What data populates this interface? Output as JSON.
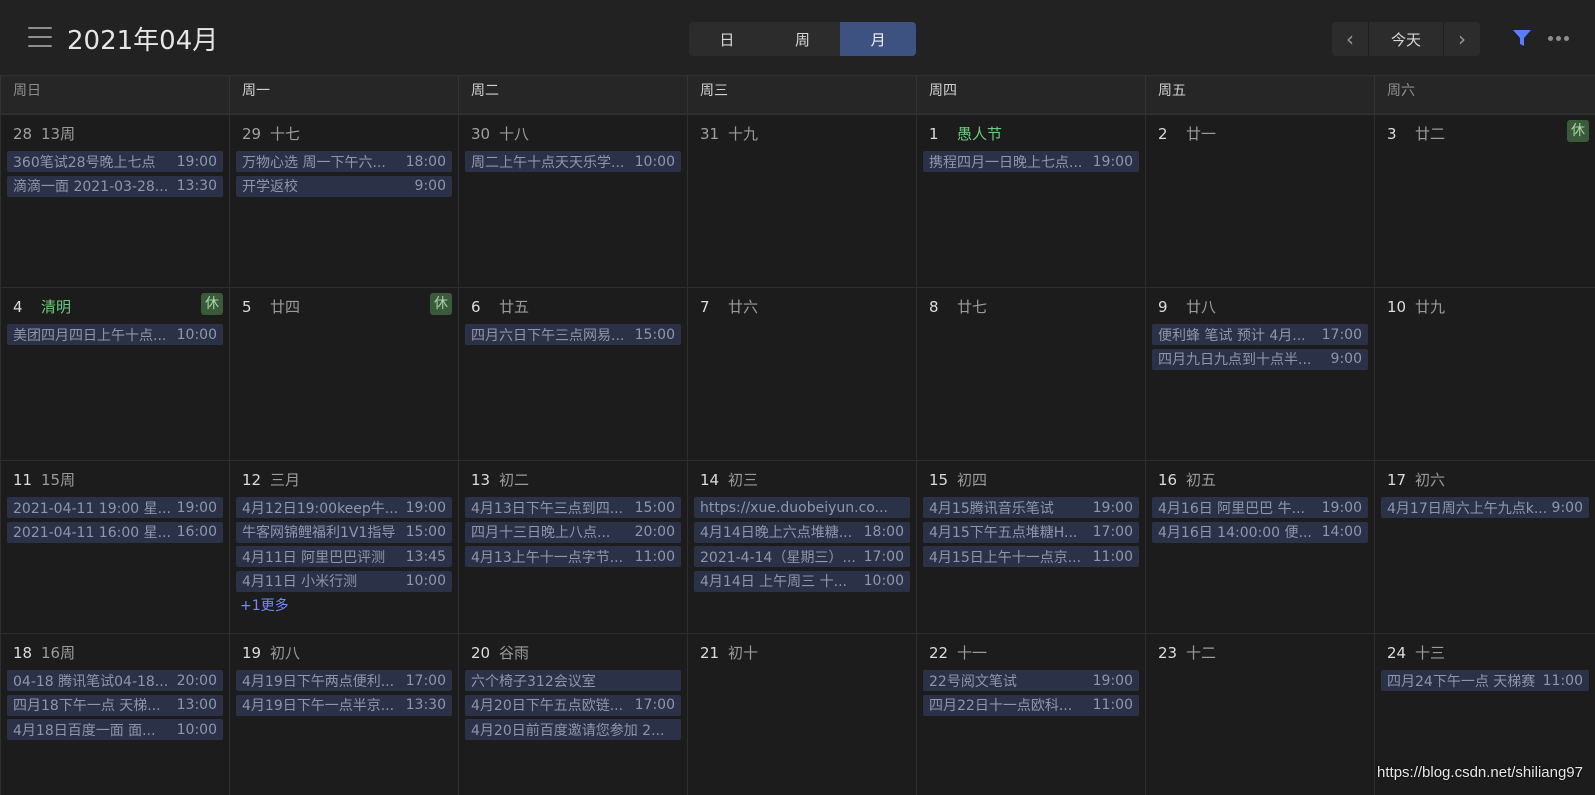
{
  "header": {
    "title": "2021年04月",
    "menu_icon": "hamburger-menu-icon",
    "views": [
      {
        "label": "日",
        "active": false
      },
      {
        "label": "周",
        "active": false
      },
      {
        "label": "月",
        "active": true
      }
    ],
    "nav": {
      "prev_icon": "chevron-left-icon",
      "today_label": "今天",
      "next_icon": "chevron-right-icon"
    },
    "filter_icon": "filter-icon",
    "more_icon": "more-horizontal-icon",
    "accent_color": "#3e5282",
    "filter_color": "#5a7dff"
  },
  "weekdays": [
    "周日",
    "周一",
    "周二",
    "周三",
    "周四",
    "周五",
    "周六"
  ],
  "weeks": [
    [
      {
        "day": "28",
        "lunar": "13周",
        "prev": true,
        "events": [
          {
            "title": "360笔试28号晚上七点",
            "time": "19:00"
          },
          {
            "title": "滴滴一面 2021-03-28...",
            "time": "13:30"
          }
        ]
      },
      {
        "day": "29",
        "lunar": "十七",
        "prev": true,
        "events": [
          {
            "title": "万物心选 周一下午六...",
            "time": "18:00"
          },
          {
            "title": "开学返校",
            "time": "9:00"
          }
        ]
      },
      {
        "day": "30",
        "lunar": "十八",
        "prev": true,
        "events": [
          {
            "title": "周二上午十点天天乐学...",
            "time": "10:00"
          }
        ]
      },
      {
        "day": "31",
        "lunar": "十九",
        "prev": true,
        "events": []
      },
      {
        "day": "1",
        "lunar": "愚人节",
        "festival": true,
        "events": [
          {
            "title": "携程四月一日晚上七点...",
            "time": "19:00"
          }
        ]
      },
      {
        "day": "2",
        "lunar": "廿一",
        "events": []
      },
      {
        "day": "3",
        "lunar": "廿二",
        "rest": "休",
        "events": []
      }
    ],
    [
      {
        "day": "4",
        "lunar": "清明",
        "festival": true,
        "rest": "休",
        "events": [
          {
            "title": "美团四月四日上午十点...",
            "time": "10:00"
          }
        ]
      },
      {
        "day": "5",
        "lunar": "廿四",
        "rest": "休",
        "events": []
      },
      {
        "day": "6",
        "lunar": "廿五",
        "events": [
          {
            "title": "四月六日下午三点网易...",
            "time": "15:00"
          }
        ]
      },
      {
        "day": "7",
        "lunar": "廿六",
        "events": []
      },
      {
        "day": "8",
        "lunar": "廿七",
        "events": []
      },
      {
        "day": "9",
        "lunar": "廿八",
        "events": [
          {
            "title": "便利蜂 笔试 预计 4月...",
            "time": "17:00"
          },
          {
            "title": "四月九日九点到十点半...",
            "time": "9:00"
          }
        ]
      },
      {
        "day": "10",
        "lunar": "廿九",
        "events": []
      }
    ],
    [
      {
        "day": "11",
        "lunar": "15周",
        "events": [
          {
            "title": "2021-04-11 19:00 星...",
            "time": "19:00"
          },
          {
            "title": "2021-04-11 16:00 星...",
            "time": "16:00"
          }
        ]
      },
      {
        "day": "12",
        "lunar": "三月",
        "more": "+1更多",
        "events": [
          {
            "title": "4月12日19:00keep牛...",
            "time": "19:00"
          },
          {
            "title": "牛客网锦鲤福利1V1指导",
            "time": "15:00"
          },
          {
            "title": "4月11日 阿里巴巴评测",
            "time": "13:45"
          },
          {
            "title": "4月11日 小米行测",
            "time": "10:00"
          }
        ]
      },
      {
        "day": "13",
        "lunar": "初二",
        "events": [
          {
            "title": "4月13日下午三点到四...",
            "time": "15:00"
          },
          {
            "title": "四月十三日晚上八点...",
            "time": "20:00"
          },
          {
            "title": "4月13上午十一点字节...",
            "time": "11:00"
          }
        ]
      },
      {
        "day": "14",
        "lunar": "初三",
        "events": [
          {
            "title": "https://xue.duobeiyun.co...",
            "time": ""
          },
          {
            "title": "4月14日晚上六点堆糖...",
            "time": "18:00"
          },
          {
            "title": "2021-4-14（星期三）...",
            "time": "17:00"
          },
          {
            "title": "4月14日 上午周三 十...",
            "time": "10:00"
          }
        ]
      },
      {
        "day": "15",
        "lunar": "初四",
        "events": [
          {
            "title": "4月15腾讯音乐笔试",
            "time": "19:00"
          },
          {
            "title": "4月15下午五点堆糖H...",
            "time": "17:00"
          },
          {
            "title": "4月15日上午十一点京...",
            "time": "11:00"
          }
        ]
      },
      {
        "day": "16",
        "lunar": "初五",
        "events": [
          {
            "title": "4月16日 阿里巴巴 牛...",
            "time": "19:00"
          },
          {
            "title": "4月16日 14:00:00 便...",
            "time": "14:00"
          }
        ]
      },
      {
        "day": "17",
        "lunar": "初六",
        "events": [
          {
            "title": "4月17日周六上午九点k...",
            "time": "9:00"
          }
        ]
      }
    ],
    [
      {
        "day": "18",
        "lunar": "16周",
        "events": [
          {
            "title": "04-18 腾讯笔试04-18...",
            "time": "20:00"
          },
          {
            "title": "四月18下午一点 天梯...",
            "time": "13:00"
          },
          {
            "title": "4月18日百度一面 面...",
            "time": "10:00"
          }
        ]
      },
      {
        "day": "19",
        "lunar": "初八",
        "events": [
          {
            "title": "4月19日下午两点便利...",
            "time": "17:00"
          },
          {
            "title": "4月19日下午一点半京...",
            "time": "13:30"
          }
        ]
      },
      {
        "day": "20",
        "lunar": "谷雨",
        "events": [
          {
            "title": "六个椅子312会议室",
            "time": ""
          },
          {
            "title": "4月20日下午五点欧链...",
            "time": "17:00"
          },
          {
            "title": "4月20日前百度邀请您参加 2...",
            "time": ""
          }
        ]
      },
      {
        "day": "21",
        "lunar": "初十",
        "events": []
      },
      {
        "day": "22",
        "lunar": "十一",
        "events": [
          {
            "title": "22号阅文笔试",
            "time": "19:00"
          },
          {
            "title": "四月22日十一点欧科...",
            "time": "11:00"
          }
        ]
      },
      {
        "day": "23",
        "lunar": "十二",
        "events": []
      },
      {
        "day": "24",
        "lunar": "十三",
        "events": [
          {
            "title": "四月24下午一点 天梯赛",
            "time": "11:00"
          }
        ]
      }
    ]
  ],
  "watermark": "https://blog.csdn.net/shiliang97"
}
